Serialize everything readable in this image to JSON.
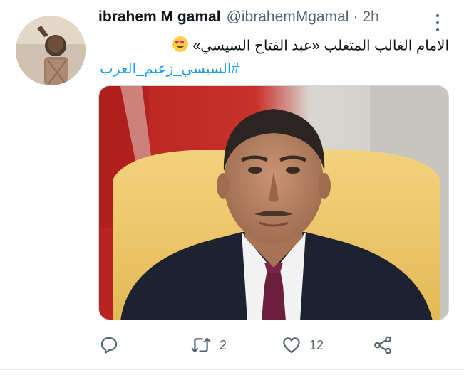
{
  "tweet": {
    "author_name": "ibrahem M gamal",
    "handle": "@ibrahemMgamal",
    "separator": "·",
    "time": "2h",
    "text": "الامام الغالب المتغلب «عبد الفتاح السيسي»",
    "emoji": "smiling-face-with-heart-eyes",
    "hashtag": "#السيسي_زعيم_العرب",
    "media": "photo-portrait-man-in-suit"
  },
  "actions": {
    "reply_count": "",
    "retweet_count": "2",
    "like_count": "12"
  },
  "colors": {
    "link": "#1d9bf0",
    "muted": "#536471",
    "text": "#0f1419"
  }
}
